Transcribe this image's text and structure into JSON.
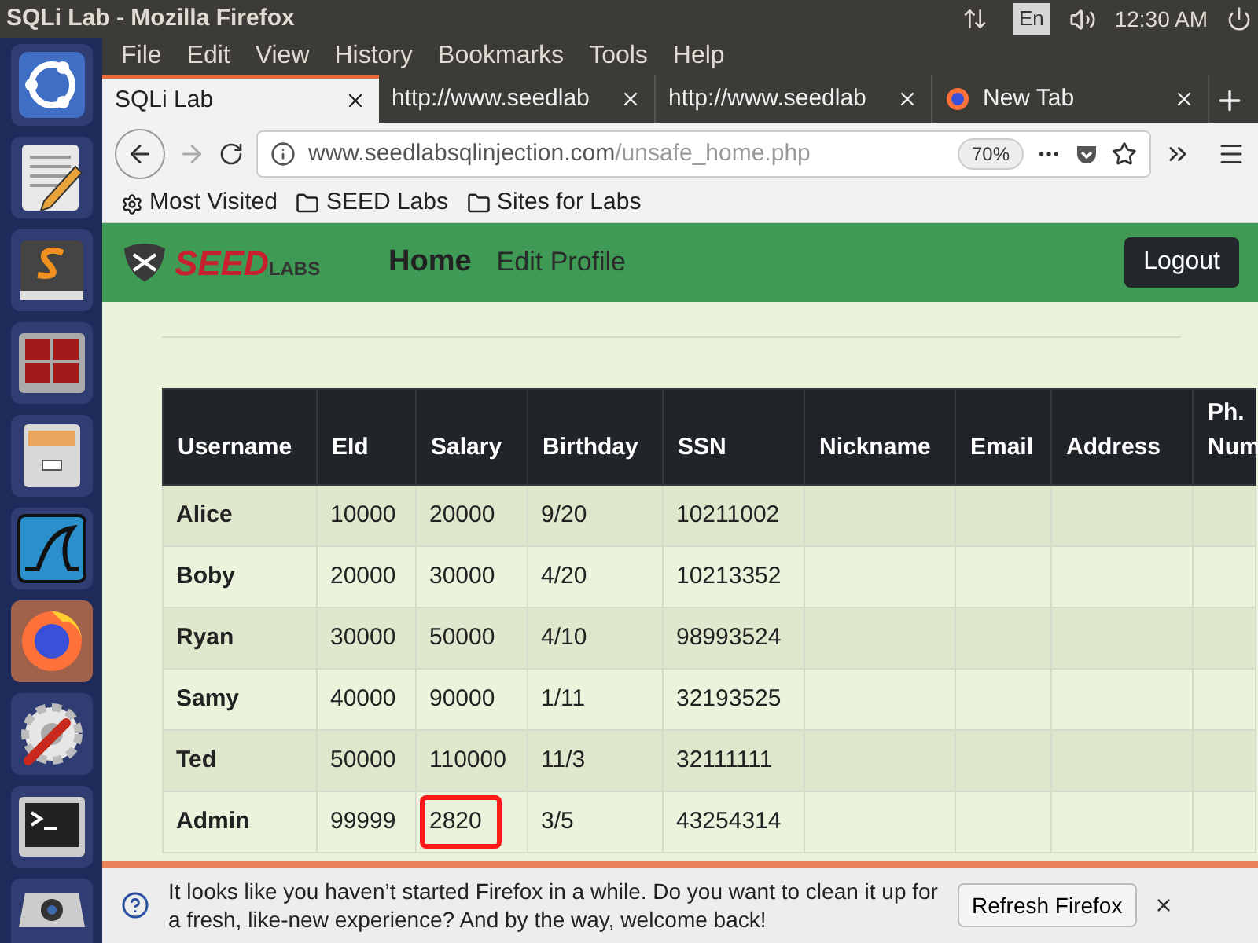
{
  "top_panel": {
    "title": "SQLi Lab - Mozilla Firefox",
    "keyboard": "En",
    "clock": "12:30 AM"
  },
  "launcher": [
    {
      "kind": "ubuntu",
      "active": false
    },
    {
      "kind": "editor",
      "active": false
    },
    {
      "kind": "sublime",
      "active": false
    },
    {
      "kind": "terminals",
      "active": false
    },
    {
      "kind": "cabinet",
      "active": false
    },
    {
      "kind": "shark",
      "active": false
    },
    {
      "kind": "firefox",
      "active": true
    },
    {
      "kind": "settings",
      "active": false
    },
    {
      "kind": "terminal",
      "active": false
    },
    {
      "kind": "camera",
      "active": false
    }
  ],
  "menu": [
    "File",
    "Edit",
    "View",
    "History",
    "Bookmarks",
    "Tools",
    "Help"
  ],
  "tabs": [
    {
      "label": "SQLi Lab",
      "selected": true,
      "kind": "page"
    },
    {
      "label": "http://www.seedlab",
      "selected": false,
      "kind": "page"
    },
    {
      "label": "http://www.seedlab",
      "selected": false,
      "kind": "page"
    },
    {
      "label": "New Tab",
      "selected": false,
      "kind": "newtab"
    }
  ],
  "address": {
    "host": "www.seedlabsqlinjection.com",
    "path": "/unsafe_home.php",
    "zoom": "70%"
  },
  "bookmarks": [
    {
      "label": "Most Visited",
      "kind": "gear"
    },
    {
      "label": "SEED Labs",
      "kind": "folder"
    },
    {
      "label": "Sites for Labs",
      "kind": "folder"
    }
  ],
  "site_nav": {
    "logo_main": "SEED",
    "logo_sub": "LABS",
    "links": [
      {
        "label": "Home",
        "selected": true
      },
      {
        "label": "Edit Profile",
        "selected": false
      }
    ],
    "logout": "Logout"
  },
  "table": {
    "columns": [
      "Username",
      "EId",
      "Salary",
      "Birthday",
      "SSN",
      "Nickname",
      "Email",
      "Address",
      "Ph. Num"
    ],
    "rows": [
      {
        "cells": [
          "Alice",
          "10000",
          "20000",
          "9/20",
          "10211002"
        ],
        "salary_marked": false
      },
      {
        "cells": [
          "Boby",
          "20000",
          "30000",
          "4/20",
          "10213352"
        ],
        "salary_marked": false
      },
      {
        "cells": [
          "Ryan",
          "30000",
          "50000",
          "4/10",
          "98993524"
        ],
        "salary_marked": false
      },
      {
        "cells": [
          "Samy",
          "40000",
          "90000",
          "1/11",
          "32193525"
        ],
        "salary_marked": false
      },
      {
        "cells": [
          "Ted",
          "50000",
          "110000",
          "11/3",
          "32111111"
        ],
        "salary_marked": false
      },
      {
        "cells": [
          "Admin",
          "99999",
          "2820",
          "3/5",
          "43254314"
        ],
        "salary_marked": true
      }
    ]
  },
  "notification": {
    "message": "It looks like you haven’t started Firefox in a while. Do you want to clean it up for a fresh, like-new experience? And by the way, welcome back!",
    "button": "Refresh Firefox",
    "close": "×"
  }
}
